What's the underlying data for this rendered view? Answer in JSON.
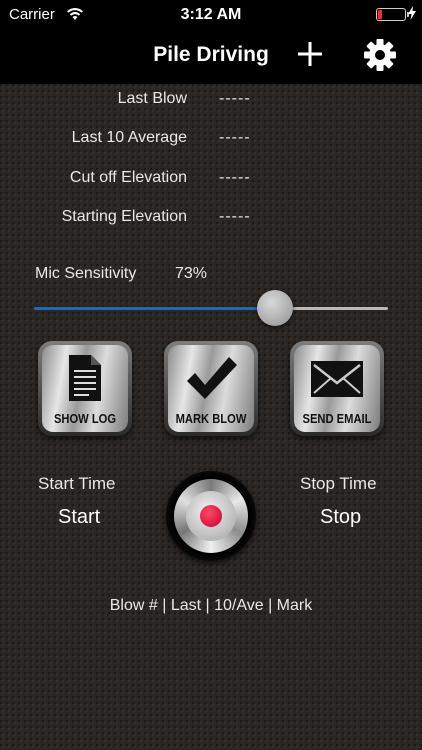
{
  "status_bar": {
    "carrier": "Carrier",
    "time": "3:12 AM",
    "battery_color": "#ff2d2d"
  },
  "nav": {
    "title": "Pile Driving"
  },
  "stats": [
    {
      "label": "Last Blow",
      "value": "-----"
    },
    {
      "label": "Last 10 Average",
      "value": "-----"
    },
    {
      "label": "Cut off Elevation",
      "value": "-----"
    },
    {
      "label": "Starting Elevation",
      "value": "-----"
    }
  ],
  "mic": {
    "label": "Mic Sensitivity",
    "value_text": "73%",
    "level": 0.73,
    "accent": "#1668d8"
  },
  "buttons": {
    "show_log": "SHOW LOG",
    "mark_blow": "MARK BLOW",
    "send_email": "SEND EMAIL"
  },
  "timing": {
    "start_label": "Start Time",
    "start_value": "Start",
    "stop_label": "Stop Time",
    "stop_value": "Stop"
  },
  "legend": "Blow # | Last | 10/Ave | Mark",
  "icons": [
    "wifi-icon",
    "battery-icon",
    "charging-bolt-icon",
    "plus-icon",
    "gear-icon",
    "document-icon",
    "checkmark-icon",
    "envelope-icon",
    "record-icon"
  ]
}
